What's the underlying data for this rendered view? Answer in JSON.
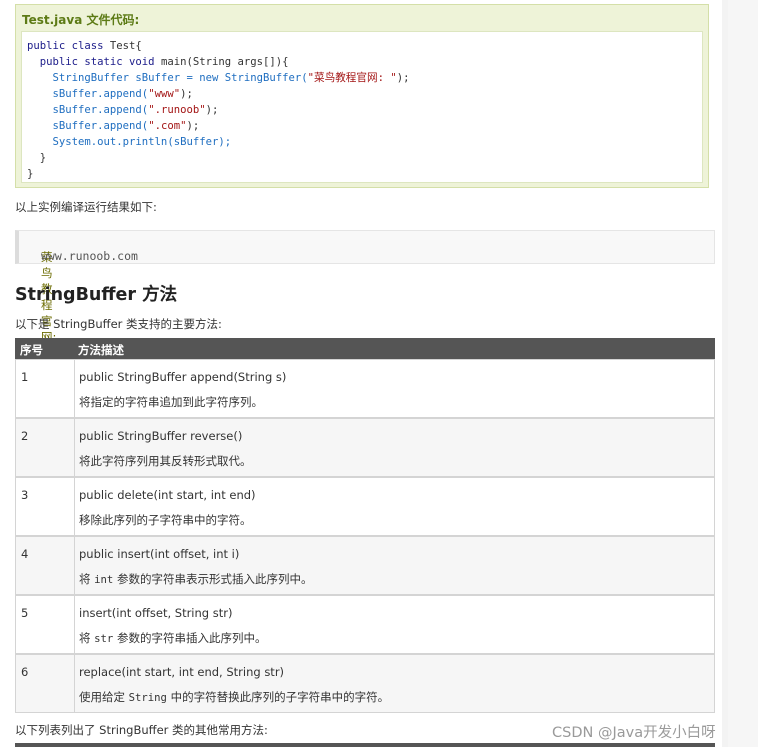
{
  "example": {
    "title": "Test.java 文件代码:",
    "code": {
      "line1_kw": "public class",
      "line1_name": " Test{",
      "line2_kw": "  public static void",
      "line2_rest": " main(String args[]){",
      "line3_a": "    StringBuffer sBuffer = new StringBuffer(",
      "line3_str": "\"菜鸟教程官网: \"",
      "line3_b": ");",
      "line4_a": "    sBuffer.append(",
      "line4_str": "\"www\"",
      "line4_b": ");",
      "line5_a": "    sBuffer.append(",
      "line5_str": "\".runoob\"",
      "line5_b": ");",
      "line6_a": "    sBuffer.append(",
      "line6_str": "\".com\"",
      "line6_b": ");",
      "line7": "    System.out.println(sBuffer);",
      "line8": "  }",
      "line9": "}"
    }
  },
  "result_intro": "以上实例编译运行结果如下:",
  "result": {
    "label": "菜鸟教程官网:",
    "value": " www.runoob.com"
  },
  "section_title": "StringBuffer 方法",
  "section_intro": "以下是 StringBuffer 类支持的主要方法:",
  "table": {
    "headers": [
      "序号",
      "方法描述"
    ],
    "rows": [
      {
        "num": "1",
        "sig": "public StringBuffer append(String s)",
        "desc_pre": "将指定的字符串追加到此字符序列。",
        "desc_code": "",
        "desc_post": ""
      },
      {
        "num": "2",
        "sig": "public StringBuffer reverse()",
        "desc_pre": " 将此字符序列用其反转形式取代。",
        "desc_code": "",
        "desc_post": ""
      },
      {
        "num": "3",
        "sig": "public delete(int start, int end)",
        "desc_pre": "移除此序列的子字符串中的字符。",
        "desc_code": "",
        "desc_post": ""
      },
      {
        "num": "4",
        "sig": "public insert(int offset, int i)",
        "desc_pre": "将 ",
        "desc_code": "int",
        "desc_post": " 参数的字符串表示形式插入此序列中。"
      },
      {
        "num": "5",
        "sig": "insert(int offset, String str)",
        "desc_pre": "将 ",
        "desc_code": "str",
        "desc_post": " 参数的字符串插入此序列中。"
      },
      {
        "num": "6",
        "sig": "replace(int start, int end, String str)",
        "desc_pre": "使用给定 ",
        "desc_code": "String",
        "desc_post": " 中的字符替换此序列的子字符串中的字符。"
      }
    ]
  },
  "other_methods_intro": "以下列表列出了 StringBuffer 类的其他常用方法:",
  "watermark": "CSDN @Java开发小白呀",
  "colors": {
    "header_bg": "#555555",
    "example_bg": "#eef3d8",
    "example_title": "#5d7b16"
  }
}
